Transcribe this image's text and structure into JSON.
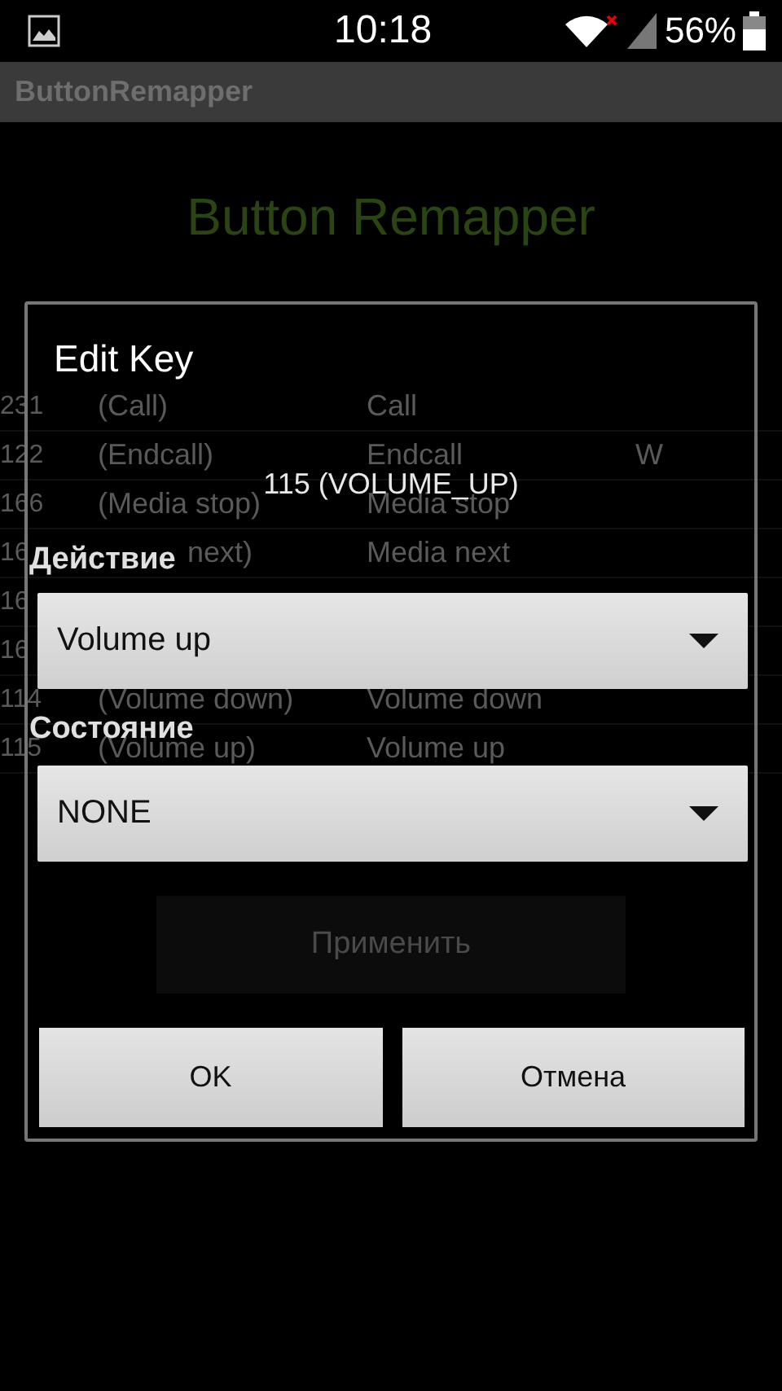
{
  "status_bar": {
    "time": "10:18",
    "battery": "56%"
  },
  "app_bar": {
    "title": "ButtonRemapper"
  },
  "page_title": "Button Remapper",
  "table": {
    "rows": [
      {
        "cells": [
          "231",
          "(Call)",
          "Call"
        ]
      },
      {
        "cells": [
          "122",
          "(Endcall)",
          "Endcall",
          "W"
        ]
      },
      {
        "cells": [
          "166",
          "(Media stop)",
          "Media stop"
        ]
      },
      {
        "cells": [
          "16",
          "next)",
          "Media next"
        ],
        "start_covered": true
      },
      {
        "cells": [
          "16"
        ]
      },
      {
        "cells": [
          "16"
        ]
      },
      {
        "cells": [
          "114",
          "(Volume down)",
          "Volume down"
        ]
      },
      {
        "cells": [
          "115",
          "(Volume up)",
          "Volume up"
        ]
      }
    ]
  },
  "apply_button": "Применить",
  "dialog": {
    "title": "Edit Key",
    "key": "115 (VOLUME_UP)",
    "fields": [
      {
        "label": "Действие",
        "value": "Volume up"
      },
      {
        "label": "Состояние",
        "value": "NONE"
      }
    ],
    "buttons": [
      "OK",
      "Отмена"
    ]
  }
}
